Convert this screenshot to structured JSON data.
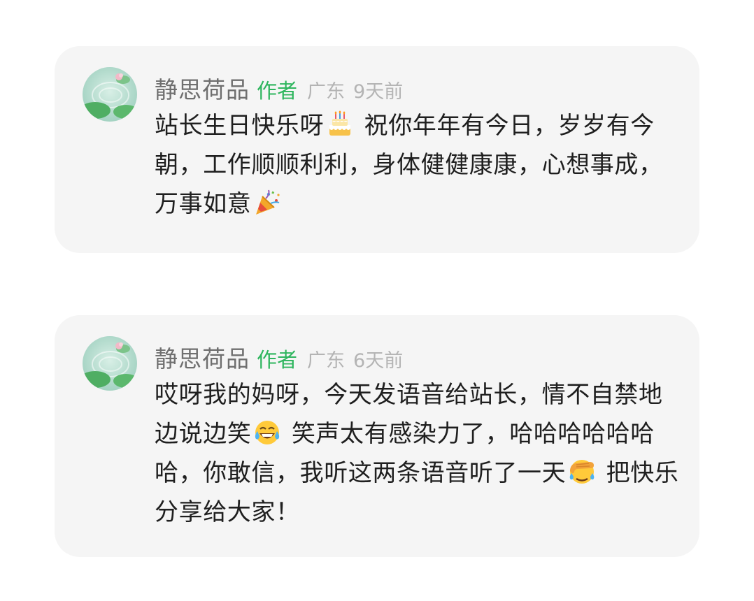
{
  "comments": [
    {
      "nickname": "静思荷品",
      "author_tag": "作者",
      "location": "广东",
      "time": "9天前",
      "text_1": "站长生日快乐呀",
      "emoji_1": "birthday-cake-icon",
      "text_2": " 祝你年年有今日，岁岁有今朝，工作顺顺利利，身体健健康康，心想事成，万事如意",
      "emoji_2": "party-popper-icon"
    },
    {
      "nickname": "静思荷品",
      "author_tag": "作者",
      "location": "广东",
      "time": "6天前",
      "text_1": "哎呀我的妈呀，今天发语音给站长，情不自禁地边说边笑",
      "emoji_1": "tears-of-joy-icon",
      "text_2": " 笑声太有感染力了，哈哈哈哈哈哈哈，你敢信，我听这两条语音听了一天",
      "emoji_2": "facepalm-laugh-icon",
      "text_3": " 把快乐分享给大家！"
    }
  ],
  "colors": {
    "card_background": "#f5f5f5",
    "author_tag": "#2db55d",
    "nickname": "#6f6f6f",
    "meta_gray": "#b4b4b4",
    "body_text": "#1f1f1f"
  }
}
